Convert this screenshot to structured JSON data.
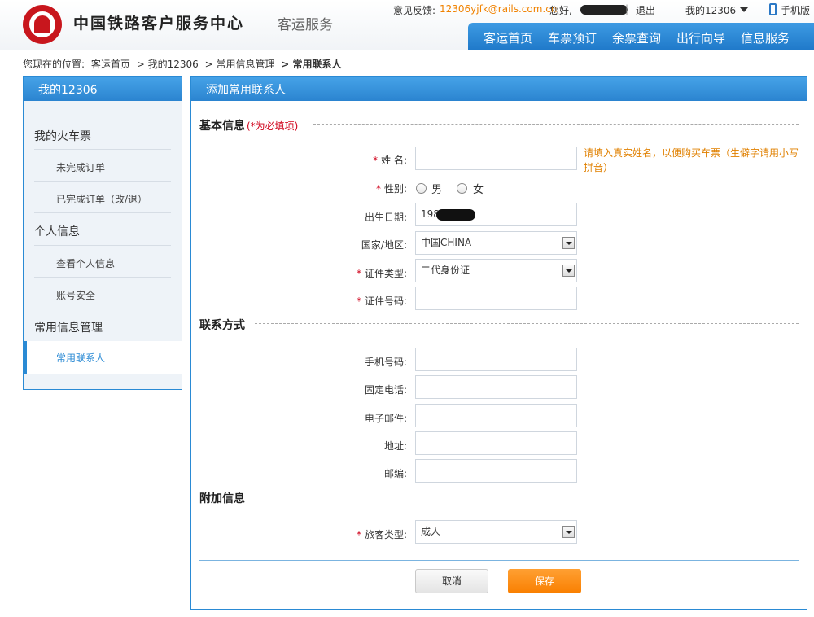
{
  "header": {
    "site_name": "中国铁路客户服务中心",
    "site_sub": "客运服务",
    "feedback_label": "意见反馈:",
    "feedback_email": "12306yjfk@rails.com.cn",
    "hello": "您好,",
    "separator": "|",
    "logout": "退出",
    "my12306": "我的12306",
    "phone": "手机版",
    "nav": [
      "客运首页",
      "车票预订",
      "余票查询",
      "出行向导",
      "信息服务"
    ]
  },
  "breadcrumb": {
    "prefix": "您现在的位置:",
    "items": [
      "客运首页",
      "> 我的12306",
      "> 常用信息管理"
    ],
    "current": "> 常用联系人"
  },
  "sidebar": {
    "title": "我的12306",
    "sections": [
      {
        "label": "我的火车票",
        "items": [
          "未完成订单",
          "已完成订单（改/退）"
        ]
      },
      {
        "label": "个人信息",
        "items": [
          "查看个人信息",
          "账号安全"
        ]
      },
      {
        "label": "常用信息管理",
        "items": [
          "常用联系人"
        ]
      }
    ]
  },
  "main": {
    "title": "添加常用联系人",
    "basic": {
      "title": "基本信息",
      "note": "(*为必填项)",
      "req": "*",
      "name_label": "姓  名:",
      "name_value": "",
      "name_hint": "请填入真实姓名，以便购买车票（生僻字请用小写拼音）",
      "gender_label": "性别:",
      "gender_male": "男",
      "gender_female": "女",
      "birth_label": "出生日期:",
      "birth_value": "198",
      "country_label": "国家/地区:",
      "country_value": "中国CHINA",
      "idtype_label": "证件类型:",
      "idtype_value": "二代身份证",
      "idno_label": "证件号码:",
      "idno_value": ""
    },
    "contact": {
      "title": "联系方式",
      "mobile_label": "手机号码:",
      "phone_label": "固定电话:",
      "email_label": "电子邮件:",
      "address_label": "地址:",
      "zip_label": "邮编:"
    },
    "extra": {
      "title": "附加信息",
      "req": "*",
      "type_label": "旅客类型:",
      "type_value": "成人"
    },
    "cancel": "取消",
    "save": "保存"
  }
}
